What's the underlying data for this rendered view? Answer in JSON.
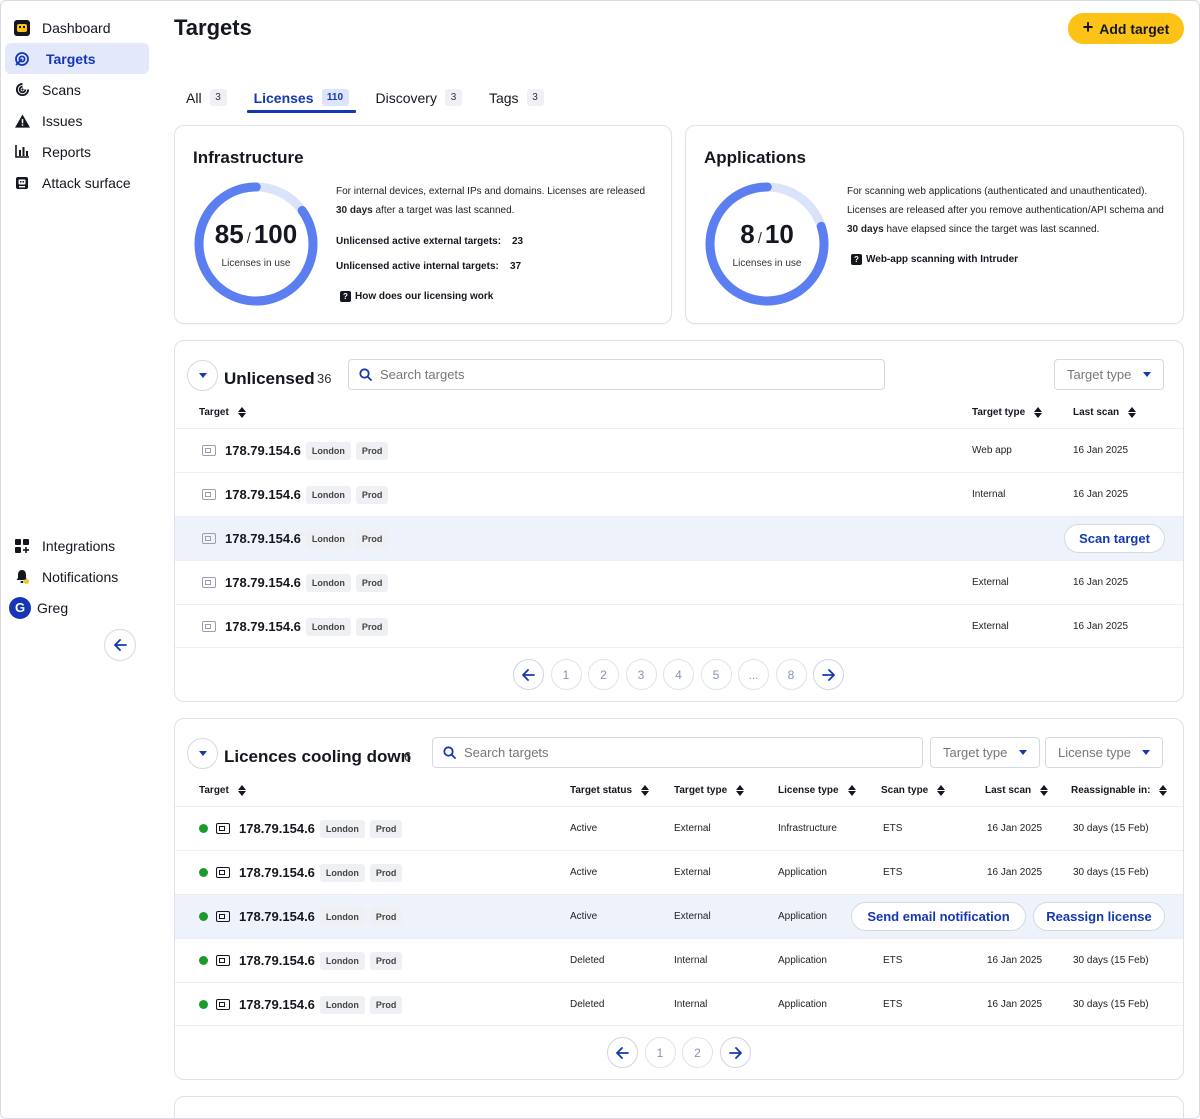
{
  "sidebar": {
    "items": [
      {
        "label": "Dashboard",
        "icon": "intruder-logo-icon"
      },
      {
        "label": "Targets",
        "icon": "target-icon",
        "active": true
      },
      {
        "label": "Scans",
        "icon": "scan-icon"
      },
      {
        "label": "Issues",
        "icon": "warning-icon"
      },
      {
        "label": "Reports",
        "icon": "bar-chart-icon"
      },
      {
        "label": "Attack surface",
        "icon": "attack-surface-icon"
      }
    ],
    "bottom": [
      {
        "label": "Integrations",
        "icon": "grid-plus-icon"
      },
      {
        "label": "Notifications",
        "icon": "bell-icon"
      },
      {
        "label": "Greg",
        "avatar": "G"
      }
    ]
  },
  "header": {
    "title": "Targets",
    "add_label": "Add target"
  },
  "tabs": [
    {
      "label": "All",
      "count": "3"
    },
    {
      "label": "Licenses",
      "count": "110",
      "active": true
    },
    {
      "label": "Discovery",
      "count": "3"
    },
    {
      "label": "Tags",
      "count": "3"
    }
  ],
  "infra": {
    "title": "Infrastructure",
    "used": "85",
    "total": "100",
    "fraction": 0.85,
    "sub": "Licenses in use",
    "desc_a": "For internal devices, external IPs and domains. Licenses are released ",
    "desc_b": "30 days",
    "desc_c": " after a target was last scanned.",
    "ext_label": "Unlicensed active external targets:",
    "ext_value": "23",
    "int_label": "Unlicensed active internal targets:",
    "int_value": "37",
    "help": "How does our licensing work"
  },
  "apps": {
    "title": "Applications",
    "used": "8",
    "total": "10",
    "fraction": 0.8,
    "sub": "Licenses in use",
    "desc_a": "For scanning web applications (authenticated and unauthenticated). Licenses are released after you remove authentication/API schema and ",
    "desc_b": "30 days",
    "desc_c": " have elapsed since the target was last scanned.",
    "help": "Web-app scanning with Intruder"
  },
  "unlicensed": {
    "title": "Unlicensed",
    "count": "36",
    "search_placeholder": "Search targets",
    "filter": "Target type",
    "headers": {
      "target": "Target",
      "type": "Target type",
      "last": "Last scan"
    },
    "rows": [
      {
        "target": "178.79.154.6",
        "tag1": "London",
        "tag2": "Prod",
        "type": "Web app",
        "last": "16 Jan 2025"
      },
      {
        "target": "178.79.154.6",
        "tag1": "London",
        "tag2": "Prod",
        "type": "Internal",
        "last": "16 Jan 2025"
      },
      {
        "target": "178.79.154.6",
        "tag1": "London",
        "tag2": "Prod",
        "type": "",
        "last": "",
        "action": "Scan target"
      },
      {
        "target": "178.79.154.6",
        "tag1": "London",
        "tag2": "Prod",
        "type": "External",
        "last": "16 Jan 2025"
      },
      {
        "target": "178.79.154.6",
        "tag1": "London",
        "tag2": "Prod",
        "type": "External",
        "last": "16 Jan 2025"
      }
    ],
    "pages": [
      "1",
      "2",
      "3",
      "4",
      "5",
      "...",
      "8"
    ]
  },
  "cooling": {
    "title": "Licences cooling down",
    "count": "6",
    "search_placeholder": "Search targets",
    "filter1": "Target type",
    "filter2": "License type",
    "headers": {
      "target": "Target",
      "status": "Target status",
      "type": "Target type",
      "license": "License type",
      "scan": "Scan type",
      "last": "Last scan",
      "reassign": "Reassignable in:"
    },
    "rows": [
      {
        "target": "178.79.154.6",
        "tag1": "London",
        "tag2": "Prod",
        "status": "Active",
        "type": "External",
        "license": "Infrastructure",
        "scan": "ETS",
        "last": "16 Jan 2025",
        "reassign": "30 days (15 Feb)"
      },
      {
        "target": "178.79.154.6",
        "tag1": "London",
        "tag2": "Prod",
        "status": "Active",
        "type": "External",
        "license": "Application",
        "scan": "ETS",
        "last": "16 Jan 2025",
        "reassign": "30 days (15 Feb)"
      },
      {
        "target": "178.79.154.6",
        "tag1": "London",
        "tag2": "Prod",
        "status": "Active",
        "type": "External",
        "license": "Application",
        "scan": "",
        "last": "",
        "reassign": "",
        "action1": "Send email notification",
        "action2": "Reassign license"
      },
      {
        "target": "178.79.154.6",
        "tag1": "London",
        "tag2": "Prod",
        "status": "Deleted",
        "type": "Internal",
        "license": "Application",
        "scan": "ETS",
        "last": "16 Jan 2025",
        "reassign": "30 days (15 Feb)"
      },
      {
        "target": "178.79.154.6",
        "tag1": "London",
        "tag2": "Prod",
        "status": "Deleted",
        "type": "Internal",
        "license": "Application",
        "scan": "ETS",
        "last": "16 Jan 2025",
        "reassign": "30 days (15 Feb)"
      }
    ],
    "pages": [
      "1",
      "2"
    ]
  },
  "colors": {
    "accent": "#1537b5",
    "ring": "#5b7ef0",
    "ring_bg": "#dbe3fb",
    "cta": "#fcc216",
    "status_green": "#1c9a2e"
  }
}
